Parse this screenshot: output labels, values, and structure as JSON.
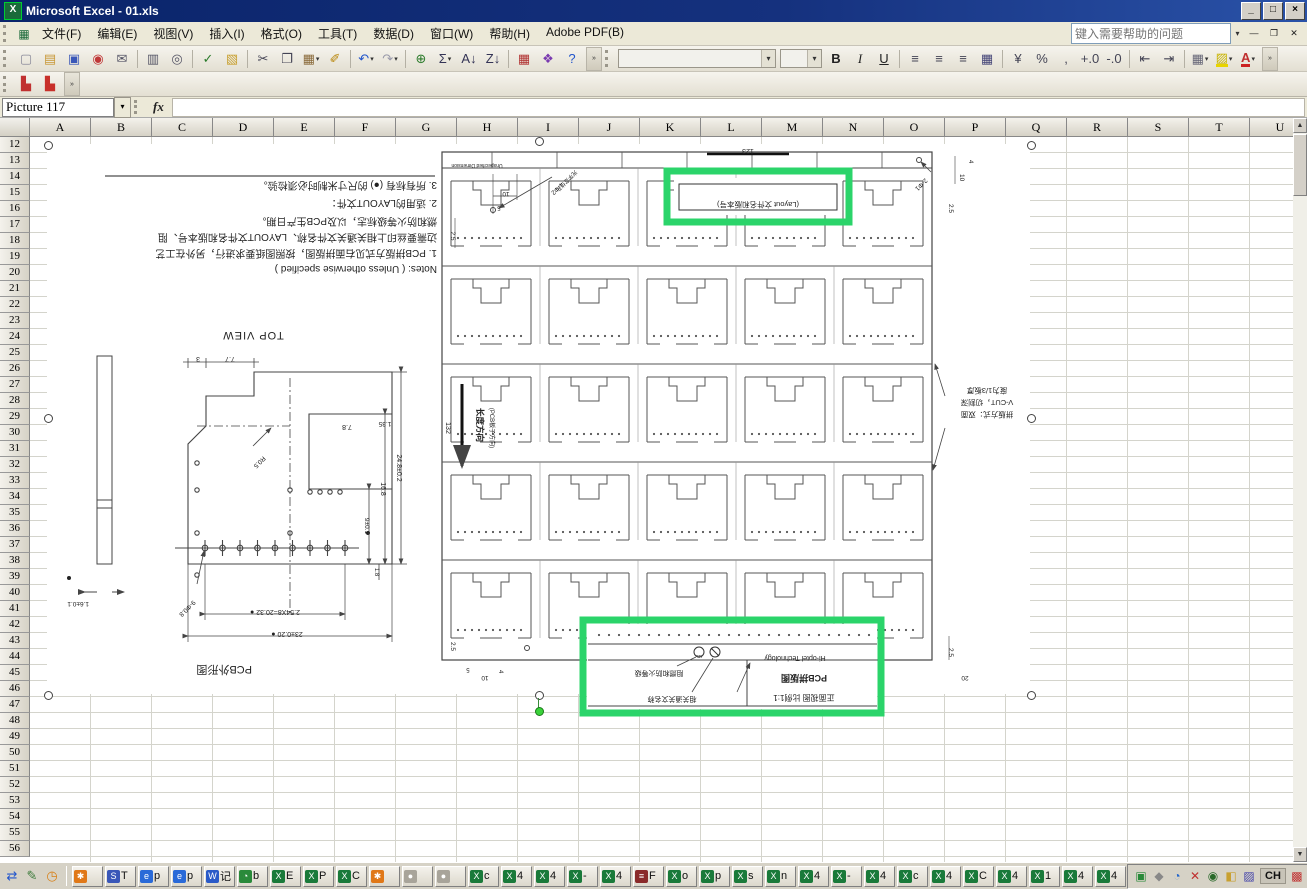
{
  "titlebar": {
    "title": "Microsoft Excel - 01.xls",
    "min": "_",
    "max": "□",
    "close": "×",
    "app_glyph": "X"
  },
  "menubar": {
    "items": [
      "文件(F)",
      "编辑(E)",
      "视图(V)",
      "插入(I)",
      "格式(O)",
      "工具(T)",
      "数据(D)",
      "窗口(W)",
      "帮助(H)",
      "Adobe PDF(B)"
    ],
    "help_placeholder": "键入需要帮助的问题",
    "help_dd": "▾",
    "win_min": "—",
    "win_restore": "❐",
    "win_close": "✕"
  },
  "toolbars": {
    "standard": [
      {
        "n": "new-icon",
        "g": "▢",
        "c": "#8a8a9a"
      },
      {
        "n": "open-icon",
        "g": "▤",
        "c": "#c89838"
      },
      {
        "n": "save-icon",
        "g": "▣",
        "c": "#3a57b8"
      },
      {
        "n": "permission-icon",
        "g": "◉",
        "c": "#c03838"
      },
      {
        "n": "mail-icon",
        "g": "✉",
        "c": "#556"
      },
      {
        "cls": "sep"
      },
      {
        "n": "print-icon",
        "g": "▥",
        "c": "#556"
      },
      {
        "n": "print-preview-icon",
        "g": "◎",
        "c": "#556"
      },
      {
        "cls": "sep"
      },
      {
        "n": "spelling-icon",
        "g": "✓",
        "c": "#2a7a2a"
      },
      {
        "n": "research-icon",
        "g": "▧",
        "c": "#c8a030"
      },
      {
        "cls": "sep"
      },
      {
        "n": "cut-icon",
        "g": "✂",
        "c": "#445"
      },
      {
        "n": "copy-icon",
        "g": "❐",
        "c": "#445"
      },
      {
        "n": "paste-icon",
        "g": "▦",
        "c": "#8a6a3a",
        "ddg": "▾"
      },
      {
        "n": "format-painter-icon",
        "g": "✐",
        "c": "#b8860b"
      },
      {
        "cls": "sep"
      },
      {
        "n": "undo-icon",
        "g": "↶",
        "c": "#2255cc",
        "ddg": "▾"
      },
      {
        "n": "redo-icon",
        "g": "↷",
        "c": "#99a",
        "ddg": "▾"
      },
      {
        "cls": "sep"
      },
      {
        "n": "hyperlink-icon",
        "g": "⊕",
        "c": "#2a7a2a"
      },
      {
        "n": "autosum-icon",
        "g": "Σ",
        "c": "#335",
        "ddg": "▾"
      },
      {
        "n": "sort-ascending-icon",
        "g": "A↓",
        "c": "#335"
      },
      {
        "n": "sort-descending-icon",
        "g": "Z↓",
        "c": "#335"
      },
      {
        "cls": "sep"
      },
      {
        "n": "chart-wizard-icon",
        "g": "▦",
        "c": "#b03030"
      },
      {
        "n": "drawing-icon",
        "g": "❖",
        "c": "#7a3ab0"
      },
      {
        "n": "help-icon",
        "g": "?",
        "c": "#2255cc"
      }
    ],
    "formatting": [
      {
        "n": "bold-icon",
        "g": "B",
        "c": "#222",
        "cls": "fb"
      },
      {
        "n": "italic-icon",
        "g": "I",
        "c": "#222",
        "cls": "fi"
      },
      {
        "n": "underline-icon",
        "g": "U",
        "c": "#222",
        "cls": "fu"
      },
      {
        "cls": "sep"
      },
      {
        "n": "align-left-icon",
        "g": "≡",
        "c": "#445"
      },
      {
        "n": "align-center-icon",
        "g": "≡",
        "c": "#445"
      },
      {
        "n": "align-right-icon",
        "g": "≡",
        "c": "#445"
      },
      {
        "n": "merge-center-icon",
        "g": "▦",
        "c": "#447"
      },
      {
        "cls": "sep"
      },
      {
        "n": "currency-icon",
        "g": "¥",
        "c": "#445"
      },
      {
        "n": "percent-icon",
        "g": "%",
        "c": "#445"
      },
      {
        "n": "comma-icon",
        "g": ",",
        "c": "#445"
      },
      {
        "n": "increase-decimal-icon",
        "g": "+.0",
        "c": "#445"
      },
      {
        "n": "decrease-decimal-icon",
        "g": "-.0",
        "c": "#445"
      },
      {
        "cls": "sep"
      },
      {
        "n": "decrease-indent-icon",
        "g": "⇤",
        "c": "#445"
      },
      {
        "n": "increase-indent-icon",
        "g": "⇥",
        "c": "#445"
      },
      {
        "cls": "sep"
      },
      {
        "n": "borders-icon",
        "g": "▦",
        "c": "#667",
        "ddg": "▾"
      },
      {
        "n": "fill-color-icon",
        "g": "▨",
        "c": "#c8b400",
        "ddg": "▾",
        "cls": "ful"
      },
      {
        "n": "font-color-icon",
        "g": "A",
        "c": "#c03030",
        "ddg": "▾",
        "cls": "ful2"
      }
    ],
    "pdf": [
      {
        "n": "convert-to-pdf-icon",
        "g": "▙",
        "c": "#c03030"
      },
      {
        "n": "convert-to-pdf-email-icon",
        "g": "▙",
        "c": "#c8302a"
      }
    ],
    "chevron": "»"
  },
  "formula_bar": {
    "name_box": "Picture 117",
    "name_dd": "▾",
    "fx_label": "fx"
  },
  "sheet": {
    "columns": [
      "A",
      "B",
      "C",
      "D",
      "E",
      "F",
      "G",
      "H",
      "I",
      "J",
      "K",
      "L",
      "M",
      "N",
      "O",
      "P",
      "Q",
      "R",
      "S",
      "T",
      "U"
    ],
    "rows": [
      "12",
      "13",
      "14",
      "15",
      "16",
      "17",
      "18",
      "19",
      "20",
      "21",
      "22",
      "23",
      "24",
      "25",
      "26",
      "27",
      "28",
      "29",
      "30",
      "31",
      "32",
      "33",
      "34",
      "35",
      "36",
      "37",
      "38",
      "39",
      "40",
      "41",
      "42",
      "43",
      "44",
      "45",
      "46",
      "47",
      "48",
      "49",
      "50",
      "51",
      "52",
      "53",
      "54",
      "55",
      "56"
    ],
    "scroll_up": "▲",
    "scroll_down": "▼"
  },
  "picture": {
    "notes_lines": [
      "Notes: ( Unless otherwise specified )",
      "1. PCB拼版方式见右面拼版图，按照图纸要求进行，另外在工艺",
      "边需要丝印上相关通关文件名称、LAYOUT文件名和版本号、阻",
      "燃和防火等级标志，以及PCB生产日期。",
      "2. 适用的LAYOUT文件：",
      "3. 所有标有 (●) 的尺寸米制时必须检验。"
    ],
    "top_view": "TOP VIEW",
    "outline_label": "PCB外形图",
    "dims": {
      "d3": "3",
      "d77": "7.7",
      "d78": "7.8",
      "d135": "1.35",
      "d248": "24.8±0.2",
      "d168": "16.8",
      "d9": "9±0.1",
      "d18": "1.8",
      "r05": "R0.5",
      "holes": "9-Φ0.8",
      "pitch": "2.54X8=20.32 ●",
      "width": "23±0.20 ●",
      "side": "1.6±0.1"
    },
    "panel": {
      "strip_note": "Unspecified Dimension",
      "d123": "123",
      "d132": "132",
      "dir1": "长度方向",
      "dir2": "(PCB板子方向)",
      "d10": "10",
      "d5": "5",
      "d25": "2.5",
      "d4": "4",
      "d20": "20",
      "holes4": "4-Φ2",
      "optics": "光学定位孔",
      "holes2": "2-Φ1"
    },
    "vcut_lines": [
      "拼版方式：双面",
      "V-CUT，切割深",
      "度为1/3板厚"
    ],
    "box1_label": "(Layout 文件名和版本号)",
    "box2": {
      "brand": "Hi-optel Technology",
      "logo": "UL",
      "title": "PCB拼版图",
      "scale": "正面视图 比例1:1",
      "note1": "阻燃和防火等级",
      "note2": "相关通关文名称"
    },
    "highlight": "#2bd46a"
  },
  "taskbar": {
    "quick_launch": [
      {
        "n": "sync-icon",
        "g": "⇄",
        "c": "#2255cc"
      },
      {
        "n": "notepad-icon",
        "g": "✎",
        "c": "#3a7a3a"
      },
      {
        "n": "clock-icon",
        "g": "◷",
        "c": "#d88018"
      }
    ],
    "buttons": [
      {
        "bg": "#e07818",
        "g": "✱",
        "t": ""
      },
      {
        "bg": "#3a57b8",
        "g": "S",
        "t": "T"
      },
      {
        "bg": "#2a6ad8",
        "g": "e",
        "t": "p"
      },
      {
        "bg": "#2a6ad8",
        "g": "e",
        "t": "p"
      },
      {
        "bg": "#2a5ac8",
        "g": "W",
        "t": "记"
      },
      {
        "bg": "#2a8a3a",
        "g": "◔",
        "t": "b"
      },
      {
        "bg": "#1a7a3a",
        "g": "X",
        "t": "E"
      },
      {
        "bg": "#1a7a3a",
        "g": "X",
        "t": "P"
      },
      {
        "bg": "#1a7a3a",
        "g": "X",
        "t": "C"
      },
      {
        "bg": "#e07818",
        "g": "✱",
        "t": ""
      },
      {
        "bg": "#a8a49a",
        "g": "●",
        "t": ""
      },
      {
        "bg": "#a8a49a",
        "g": "●",
        "t": ""
      },
      {
        "bg": "#1a7a3a",
        "g": "X",
        "t": "c"
      },
      {
        "bg": "#1a7a3a",
        "g": "X",
        "t": "4"
      },
      {
        "bg": "#1a7a3a",
        "g": "X",
        "t": "4"
      },
      {
        "bg": "#1a7a3a",
        "g": "X",
        "t": "-"
      },
      {
        "bg": "#1a7a3a",
        "g": "X",
        "t": "4"
      },
      {
        "bg": "#8a2a2a",
        "g": "≡",
        "t": "F"
      },
      {
        "bg": "#1a7a3a",
        "g": "X",
        "t": "o"
      },
      {
        "bg": "#1a7a3a",
        "g": "X",
        "t": "p"
      },
      {
        "bg": "#1a7a3a",
        "g": "X",
        "t": "s"
      },
      {
        "bg": "#1a7a3a",
        "g": "X",
        "t": "n"
      },
      {
        "bg": "#1a7a3a",
        "g": "X",
        "t": "4"
      },
      {
        "bg": "#1a7a3a",
        "g": "X",
        "t": "-"
      },
      {
        "bg": "#1a7a3a",
        "g": "X",
        "t": "4"
      },
      {
        "bg": "#1a7a3a",
        "g": "X",
        "t": "c"
      },
      {
        "bg": "#1a7a3a",
        "g": "X",
        "t": "4"
      },
      {
        "bg": "#1a7a3a",
        "g": "X",
        "t": "C"
      },
      {
        "bg": "#1a7a3a",
        "g": "X",
        "t": "4"
      },
      {
        "bg": "#1a7a3a",
        "g": "X",
        "t": "1"
      },
      {
        "bg": "#1a7a3a",
        "g": "X",
        "t": "4"
      },
      {
        "bg": "#1a7a3a",
        "g": "X",
        "t": "4"
      }
    ],
    "tray_icons": [
      {
        "n": "tray-app-green-icon",
        "g": "▣",
        "c": "#2a8a3a"
      },
      {
        "n": "tray-diamond-icon",
        "g": "◆",
        "c": "#888"
      },
      {
        "n": "tray-clock-icon",
        "g": "◔",
        "c": "#2266cc"
      },
      {
        "n": "tray-close-icon",
        "g": "✕",
        "c": "#c03030"
      },
      {
        "n": "tray-eye-icon",
        "g": "◉",
        "c": "#2a6a2a"
      },
      {
        "n": "tray-volume-icon",
        "g": "◧",
        "c": "#c8a030"
      },
      {
        "n": "tray-display-icon",
        "g": "▨",
        "c": "#4444aa"
      }
    ],
    "language": "CH",
    "tray_icons_after": [
      {
        "n": "tray-ime-icon",
        "g": "▩",
        "c": "#c03030"
      },
      {
        "n": "tray-input-icon",
        "g": "◭",
        "c": "#2266cc"
      }
    ]
  }
}
